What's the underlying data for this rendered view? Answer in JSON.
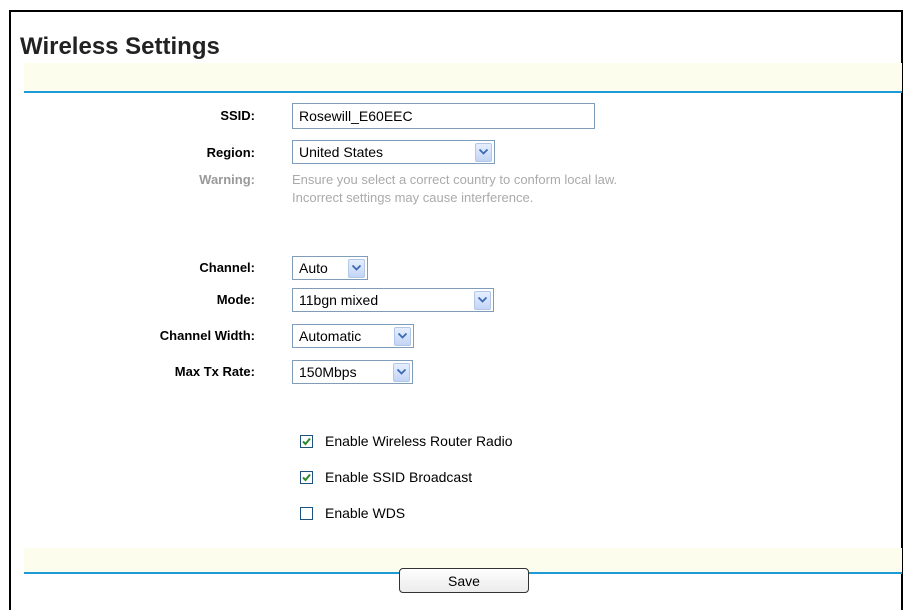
{
  "page": {
    "title": "Wireless Settings"
  },
  "form": {
    "ssid": {
      "label": "SSID:",
      "value": "Rosewill_E60EEC"
    },
    "region": {
      "label": "Region:",
      "value": "United States"
    },
    "warning": {
      "label": "Warning:",
      "line1": "Ensure you select a correct country to conform local law.",
      "line2": "Incorrect settings may cause interference."
    },
    "channel": {
      "label": "Channel:",
      "value": "Auto"
    },
    "mode": {
      "label": "Mode:",
      "value": "11bgn mixed"
    },
    "channel_width": {
      "label": "Channel Width:",
      "value": "Automatic"
    },
    "max_tx_rate": {
      "label": "Max Tx Rate:",
      "value": "150Mbps"
    },
    "options": [
      {
        "label": "Enable Wireless Router Radio",
        "checked": true
      },
      {
        "label": "Enable SSID Broadcast",
        "checked": true
      },
      {
        "label": "Enable WDS",
        "checked": false
      }
    ]
  },
  "actions": {
    "save_label": "Save"
  },
  "colors": {
    "accent": "#1e9ad6",
    "band": "#fdfdee",
    "checkmark": "#2a8a2a"
  }
}
